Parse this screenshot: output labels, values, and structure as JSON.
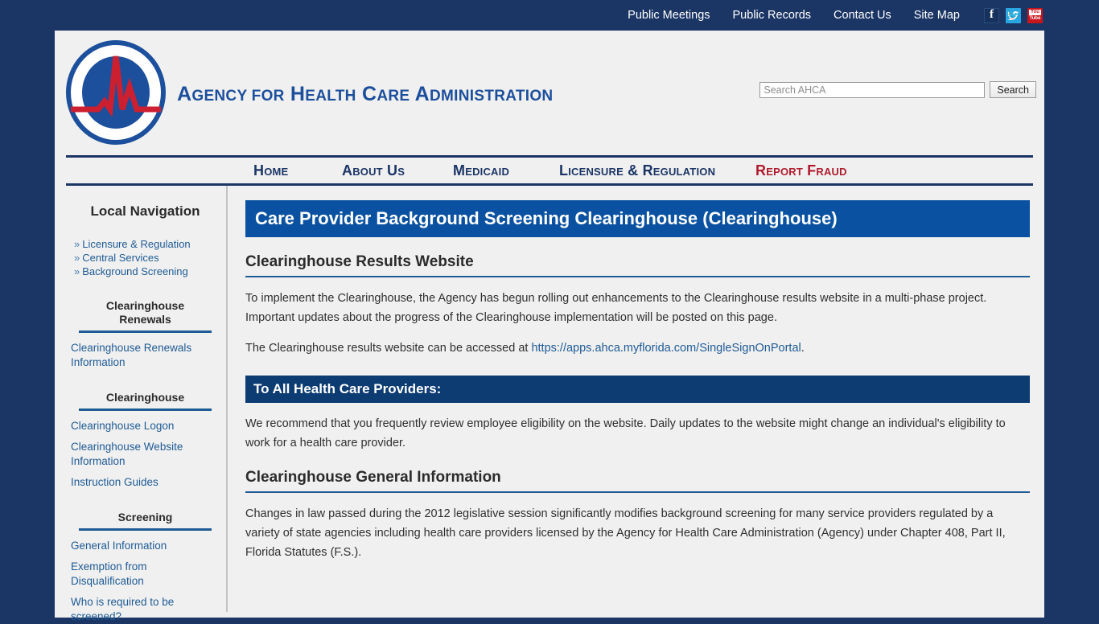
{
  "topbar": {
    "links": [
      {
        "label": "Public Meetings"
      },
      {
        "label": "Public Records"
      },
      {
        "label": "Contact Us"
      },
      {
        "label": "Site Map"
      }
    ],
    "social": [
      {
        "name": "facebook",
        "label": "f"
      },
      {
        "name": "twitter",
        "label": ""
      },
      {
        "name": "youtube",
        "label_top": "You",
        "label_bottom": "Tube"
      }
    ]
  },
  "header": {
    "org_name": "Agency for Health Care Administration",
    "logo_alt": "AHCA circular EKG logo"
  },
  "search": {
    "placeholder": "Search AHCA",
    "value": "",
    "button_label": "Search"
  },
  "mainnav": {
    "items": [
      {
        "label": "Home"
      },
      {
        "label": "About Us"
      },
      {
        "label": "Medicaid"
      },
      {
        "label": "Licensure & Regulation"
      },
      {
        "label": "Report Fraud"
      }
    ]
  },
  "sidebar": {
    "title": "Local Navigation",
    "breadcrumbs": [
      {
        "label": "Licensure & Regulation"
      },
      {
        "label": "Central Services"
      },
      {
        "label": "Background Screening"
      }
    ],
    "sections": [
      {
        "heading": "Clearinghouse Renewals",
        "links": [
          {
            "label": "Clearinghouse Renewals Information"
          }
        ]
      },
      {
        "heading": "Clearinghouse",
        "links": [
          {
            "label": "Clearinghouse Logon"
          },
          {
            "label": "Clearinghouse Website Information"
          },
          {
            "label": "Instruction Guides"
          }
        ]
      },
      {
        "heading": "Screening",
        "links": [
          {
            "label": "General Information"
          },
          {
            "label": "Exemption from Disqualification"
          },
          {
            "label": "Who is required to be screened?"
          }
        ]
      }
    ]
  },
  "content": {
    "page_title": "Care Provider Background Screening Clearinghouse (Clearinghouse)",
    "section1": {
      "heading": "Clearinghouse Results Website",
      "paragraph1": "To implement the Clearinghouse, the Agency has begun rolling out enhancements to the Clearinghouse results website in a multi-phase project.   Important updates about the progress of the Clearinghouse implementation will be posted on this page.",
      "paragraph2_prefix": "The Clearinghouse results website can be accessed at ",
      "link_text": "https://apps.ahca.myflorida.com/SingleSignOnPortal",
      "paragraph2_suffix": "."
    },
    "section2": {
      "banner": "To All Health Care Providers:",
      "paragraph": "We recommend that you frequently review employee eligibility on the website. Daily updates to the website might change an individual's eligibility to work for a health care provider."
    },
    "section3": {
      "heading": "Clearinghouse General Information",
      "paragraph": "Changes in law passed during the 2012 legislative session significantly modifies background screening for many service providers regulated by a variety of state agencies including health care providers licensed by the Agency for Health Care Administration (Agency) under Chapter 408, Part II, Florida Statutes (F.S.)."
    }
  },
  "colors": {
    "page_background": "#1b3565",
    "title_banner": "#0a52a1",
    "sub_banner": "#0d3c73",
    "link": "#1f5b95",
    "fraud": "#b01c2e",
    "logo_blue": "#1c4f9c",
    "logo_red": "#cc2030"
  }
}
